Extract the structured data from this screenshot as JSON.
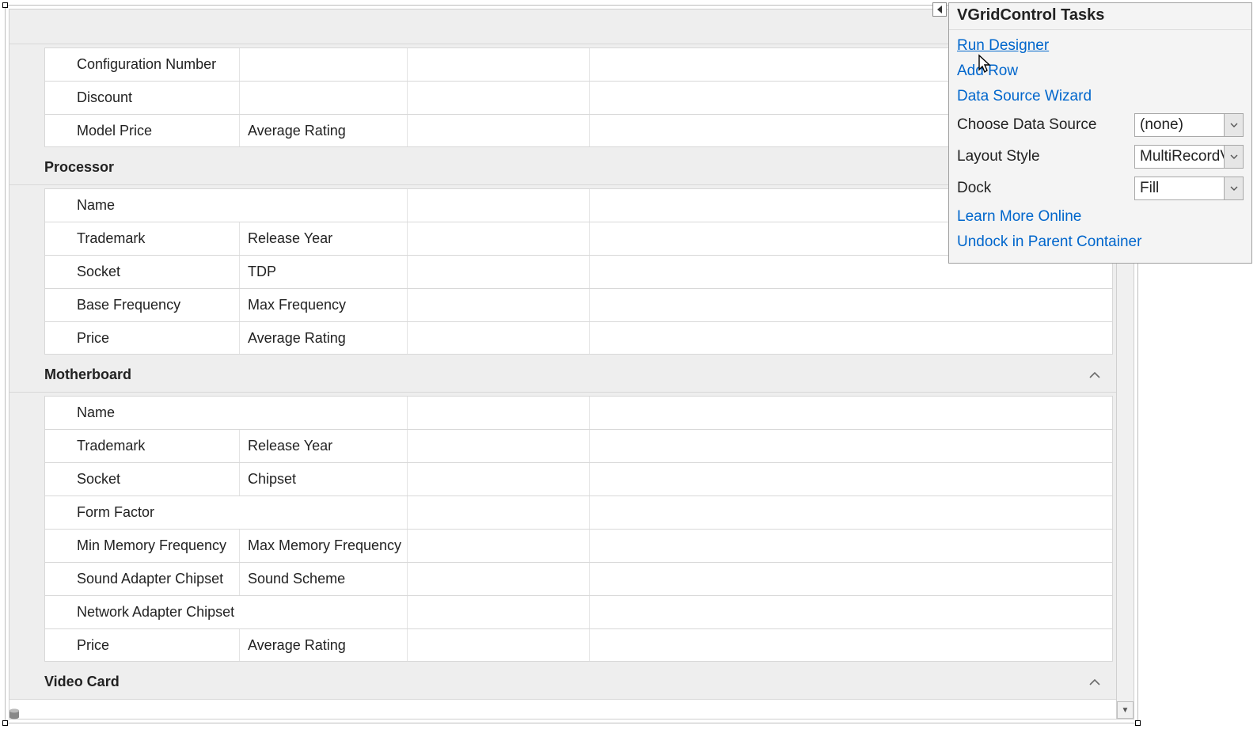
{
  "grid": {
    "categories": [
      {
        "title": "",
        "rows": [
          {
            "a": "Configuration Number",
            "b": "",
            "indent": true,
            "span": false
          },
          {
            "a": "Discount",
            "b": "",
            "indent": true,
            "span": false
          },
          {
            "a": "Model Price",
            "b": "Average Rating",
            "indent": true,
            "span": false
          }
        ]
      },
      {
        "title": "Processor",
        "rows": [
          {
            "a": "Name",
            "b": "",
            "indent": true,
            "span": true
          },
          {
            "a": "Trademark",
            "b": "Release Year",
            "indent": true,
            "span": false
          },
          {
            "a": "Socket",
            "b": "TDP",
            "indent": true,
            "span": false
          },
          {
            "a": "Base Frequency",
            "b": "Max Frequency",
            "indent": true,
            "span": false
          },
          {
            "a": "Price",
            "b": "Average Rating",
            "indent": true,
            "span": false
          }
        ]
      },
      {
        "title": "Motherboard",
        "rows": [
          {
            "a": "Name",
            "b": "",
            "indent": true,
            "span": true
          },
          {
            "a": "Trademark",
            "b": "Release Year",
            "indent": true,
            "span": false
          },
          {
            "a": "Socket",
            "b": "Chipset",
            "indent": true,
            "span": false
          },
          {
            "a": "Form Factor",
            "b": "",
            "indent": true,
            "span": true
          },
          {
            "a": "Min Memory Frequency",
            "b": "Max Memory Frequency",
            "indent": true,
            "span": false
          },
          {
            "a": "Sound Adapter Chipset",
            "b": "Sound Scheme",
            "indent": true,
            "span": false
          },
          {
            "a": "Network Adapter Chipset",
            "b": "",
            "indent": true,
            "span": true
          },
          {
            "a": "Price",
            "b": "Average Rating",
            "indent": true,
            "span": false
          }
        ]
      },
      {
        "title": "Video Card",
        "rows": []
      }
    ]
  },
  "tasks": {
    "title": "VGridControl Tasks",
    "run_designer": "Run Designer",
    "add_row": "Add Row",
    "data_source_wizard": "Data Source Wizard",
    "choose_data_source_label": "Choose Data Source",
    "choose_data_source_value": "(none)",
    "layout_style_label": "Layout Style",
    "layout_style_value": "MultiRecordView",
    "dock_label": "Dock",
    "dock_value": "Fill",
    "learn_more": "Learn More Online",
    "undock": "Undock in Parent Container"
  }
}
